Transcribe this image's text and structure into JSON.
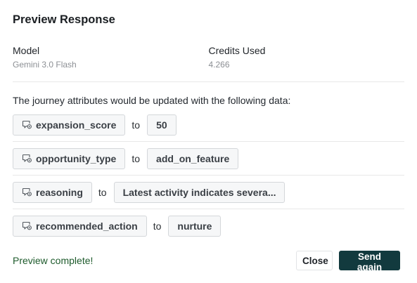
{
  "dialog": {
    "title": "Preview Response"
  },
  "meta": {
    "model_label": "Model",
    "model_value": "Gemini 3.0 Flash",
    "credits_label": "Credits Used",
    "credits_value": "4.266"
  },
  "intro": "The journey attributes would be updated with the following data:",
  "connector": "to",
  "attributes": [
    {
      "name": "expansion_score",
      "value": "50"
    },
    {
      "name": "opportunity_type",
      "value": "add_on_feature"
    },
    {
      "name": "reasoning",
      "value": "Latest activity indicates severa..."
    },
    {
      "name": "recommended_action",
      "value": "nurture"
    }
  ],
  "footer": {
    "status": "Preview complete!",
    "close_label": "Close",
    "send_label": "Send again"
  },
  "icons": {
    "attribute": "tag-attribute-icon"
  },
  "colors": {
    "primary_button": "#123a3e",
    "status_text": "#1e5b2c"
  }
}
